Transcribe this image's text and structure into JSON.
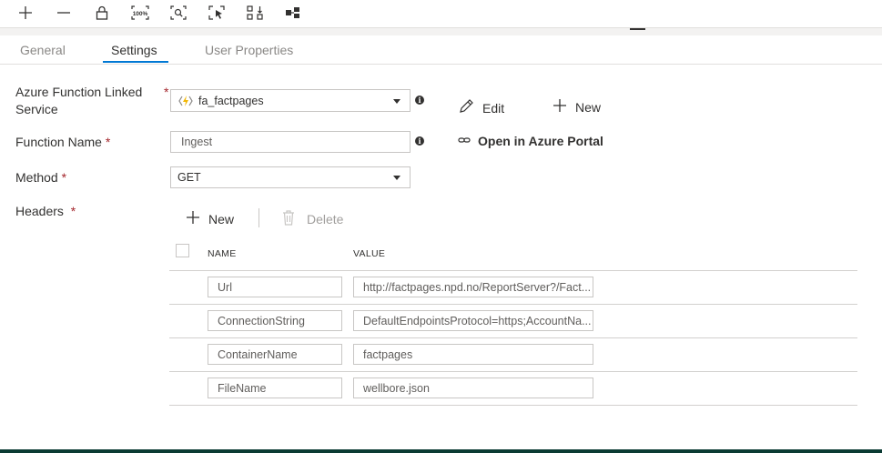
{
  "toolbar": {
    "buttons": [
      "add-icon",
      "minus-icon",
      "lock-icon",
      "zoom-100-icon",
      "zoom-fit-icon",
      "select-icon",
      "auto-align-icon",
      "layout-icon"
    ],
    "zoom_label": "100%"
  },
  "tabs": [
    {
      "label": "General",
      "active": false
    },
    {
      "label": "Settings",
      "active": true
    },
    {
      "label": "User Properties",
      "active": false
    }
  ],
  "form": {
    "linked_service": {
      "label_line1": "Azure Function Linked",
      "label_line2": "Service",
      "required": "*",
      "value": "fa_factpages"
    },
    "function_name": {
      "label": "Function Name",
      "required": "*",
      "value": "Ingest"
    },
    "method": {
      "label": "Method",
      "required": "*",
      "value": "GET"
    },
    "headers": {
      "label": "Headers",
      "required": "*"
    }
  },
  "actions": {
    "edit": "Edit",
    "new": "New",
    "open_portal": "Open in Azure Portal",
    "headers_new": "New",
    "headers_delete": "Delete"
  },
  "headers_table": {
    "columns": [
      "NAME",
      "VALUE"
    ],
    "rows": [
      {
        "name": "Url",
        "value": "http://factpages.npd.no/ReportServer?/Fact..."
      },
      {
        "name": "ConnectionString",
        "value": "DefaultEndpointsProtocol=https;AccountNa..."
      },
      {
        "name": "ContainerName",
        "value": "factpages"
      },
      {
        "name": "FileName",
        "value": "wellbore.json"
      }
    ]
  },
  "colors": {
    "accent": "#0078d4",
    "required": "#a4262c",
    "function_icon": "#f2b705"
  }
}
